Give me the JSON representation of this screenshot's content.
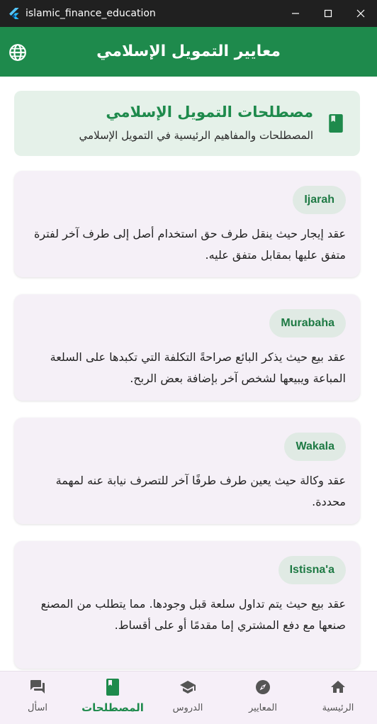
{
  "window": {
    "title": "islamic_finance_education",
    "controls": [
      "minimize-icon",
      "maximize-icon",
      "close-icon"
    ]
  },
  "appbar": {
    "title": "معايير التمويل الإسلامي",
    "language_icon": "globe-icon"
  },
  "header": {
    "title": "مصطلحات التمويل الإسلامي",
    "subtitle": "المصطلحات والمفاهيم الرئيسية في التمويل الإسلامي",
    "icon": "book-icon"
  },
  "terms": [
    {
      "name": "Ijarah",
      "definition": "عقد إيجار حيث ينقل طرف حق استخدام أصل إلى طرف آخر لفترة متفق عليها بمقابل متفق عليه."
    },
    {
      "name": "Murabaha",
      "definition": "عقد بيع حيث يذكر البائع صراحةً التكلفة التي تكبدها على السلعة المباعة ويبيعها لشخص آخر بإضافة بعض الربح."
    },
    {
      "name": "Wakala",
      "definition": "عقد وكالة حيث يعين طرف طرفًا آخر للتصرف نيابة عنه لمهمة محددة."
    },
    {
      "name": "Istisna'a",
      "definition": "عقد بيع حيث يتم تداول سلعة قبل وجودها. مما يتطلب من المصنع صنعها مع دفع المشتري إما مقدمًا أو على أقساط."
    }
  ],
  "nav": {
    "items": [
      {
        "label": "الرئيسية",
        "icon": "home-icon"
      },
      {
        "label": "المعايير",
        "icon": "compass-icon"
      },
      {
        "label": "الدروس",
        "icon": "school-icon"
      },
      {
        "label": "المصطلحات",
        "icon": "book-icon",
        "active": true
      },
      {
        "label": "اسأل",
        "icon": "chat-icon"
      }
    ]
  },
  "colors": {
    "primary": "#1e8a4c",
    "header_bg": "#e5f1e9",
    "card_bg": "#f5f0f7",
    "chip_bg": "#e0eae4",
    "nav_bg": "#f6eff8",
    "titlebar": "#202020"
  }
}
